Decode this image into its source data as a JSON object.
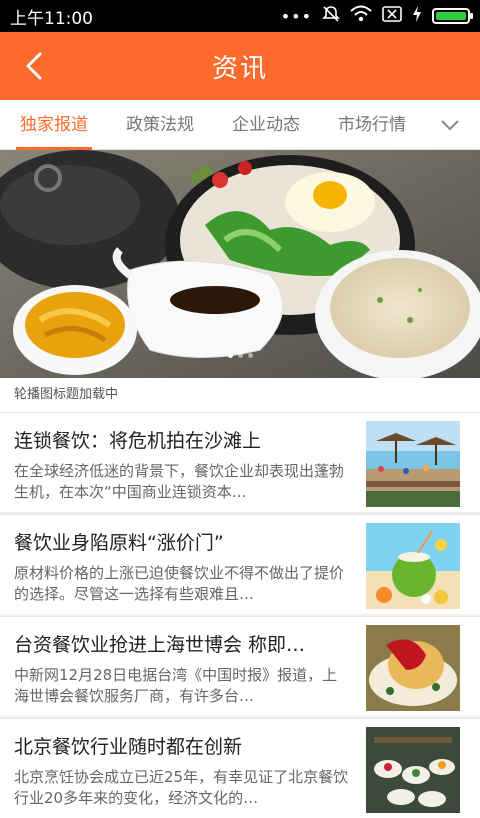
{
  "status_bar": {
    "time": "上午11:00",
    "signal_dots": "•••"
  },
  "header": {
    "title": "资讯"
  },
  "tabs": [
    {
      "label": "独家报道",
      "active": true
    },
    {
      "label": "政策法规",
      "active": false
    },
    {
      "label": "企业动态",
      "active": false
    },
    {
      "label": "市场行情",
      "active": false
    }
  ],
  "banner": {
    "caption": "轮播图标题加载中",
    "page_count": 3,
    "current_page": 1
  },
  "news": [
    {
      "title": "连锁餐饮：将危机拍在沙滩上",
      "summary": "在全球经济低迷的背景下，餐饮企业却表现出蓬勃生机，在本次“中国商业连锁资本…",
      "thumb_icon": "beach-boardwalk-photo"
    },
    {
      "title": "餐饮业身陷原料“涨价门”",
      "summary": "原材料价格的上涨已迫使餐饮业不得不做出了提价的选择。尽管这一选择有些艰难且…",
      "thumb_icon": "coconut-drink-photo"
    },
    {
      "title": "台资餐饮业抢进上海世博会 称即…",
      "summary": "中新网12月28日电据台湾《中国时报》报道，上海世博会餐饮服务厂商，有许多台…",
      "thumb_icon": "dessert-plate-photo"
    },
    {
      "title": "北京餐饮行业随时都在创新",
      "summary": "北京烹饪协会成立已近25年，有幸见证了北京餐饮行业20多年来的变化，经济文化的…",
      "thumb_icon": "banquet-dishes-photo"
    }
  ],
  "colors": {
    "accent": "#fc6b2c",
    "status_bar": "#000000",
    "battery": "#2ecc40"
  }
}
